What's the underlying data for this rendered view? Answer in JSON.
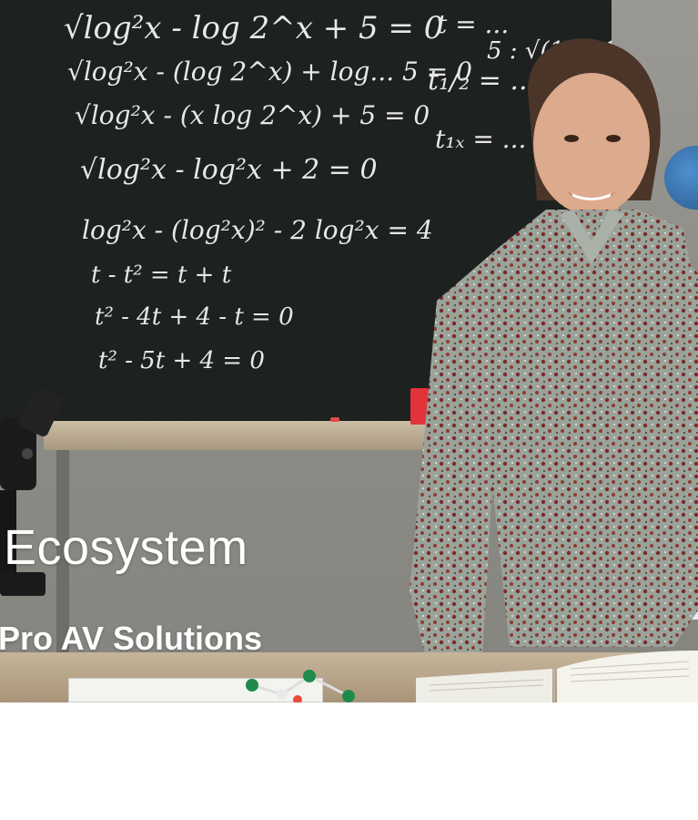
{
  "hero": {
    "title": "Ecosystem",
    "subtitle": "Pro AV Solutions",
    "image_description_name": "teacher-at-chalkboard-photo"
  },
  "blackboard": {
    "lines": [
      "√log²x - log 2^x + 5 = 0",
      "√log²x - (log 2^x) + log... 5 = 0",
      "√log²x - (x log 2^x) + 5 = 0",
      "√log²x - log²x + 2 = 0",
      "log²x - (log²x)² - 2 log²x = 4",
      "t - t² = t + t",
      "t² - 4t + 4 - t = 0",
      "t² - 5t + 4 = 0",
      "t = ...",
      "5 : √(10 - 1)",
      "t₁/₂ = ...",
      "t₁ₓ = ..."
    ]
  },
  "colors": {
    "board": "#1d211f",
    "chalk": "#e8e8e4",
    "headline": "#ffffff",
    "cup": "#e2333a"
  }
}
